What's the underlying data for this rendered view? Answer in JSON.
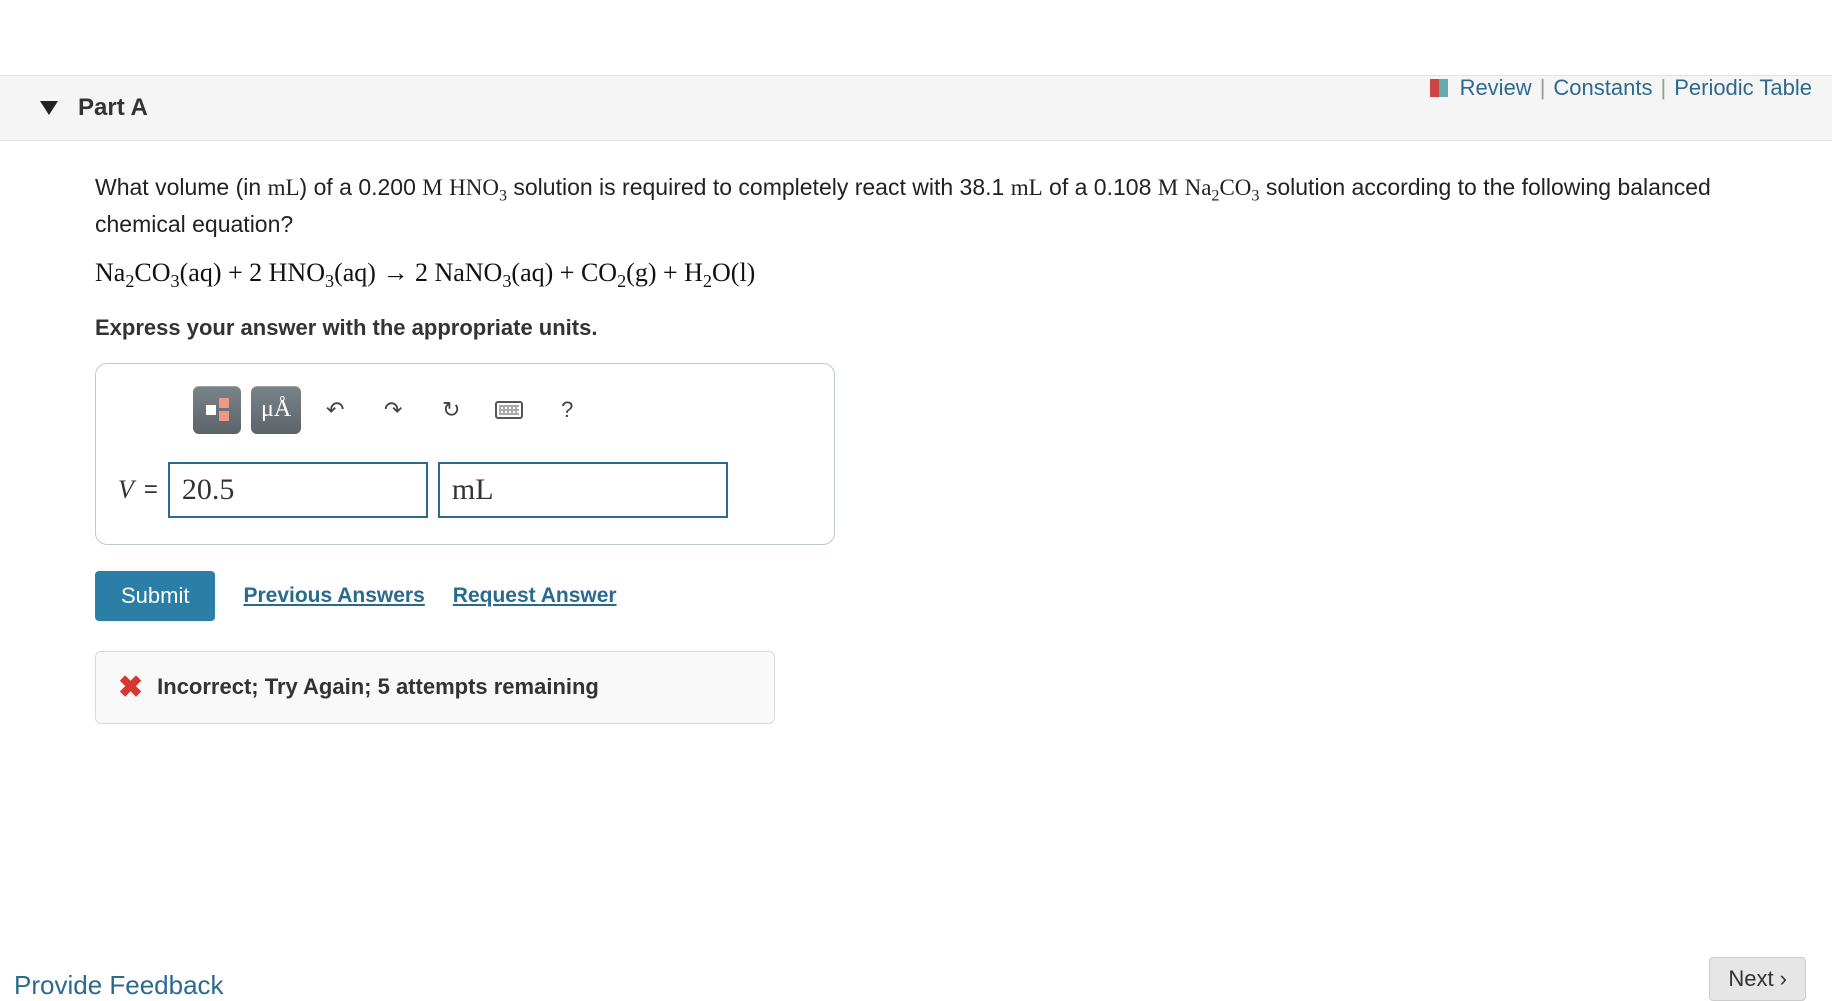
{
  "topLinks": {
    "review": "Review",
    "constants": "Constants",
    "periodic": "Periodic Table"
  },
  "part": {
    "label": "Part A"
  },
  "question": {
    "pre": "What volume (in ",
    "unit_mL": "mL",
    "seg1": ") of a 0.200 ",
    "M": "M",
    "sp": " ",
    "hno3_a": "HNO",
    "hno3_b": "3",
    "seg2": " solution is required to completely react with 38.1 ",
    "seg3": " of a 0.108 ",
    "na2co3_a": "Na",
    "na2co3_b": "2",
    "na2co3_c": "CO",
    "na2co3_d": "3",
    "seg4": " solution according to the following balanced chemical equation?"
  },
  "equation": {
    "t1": "Na",
    "s1": "2",
    "t2": "CO",
    "s2": "3",
    "t3": "(aq) + 2 HNO",
    "s3": "3",
    "t4": "(aq) → 2 NaNO",
    "s4": "3",
    "t5": "(aq) + CO",
    "s5": "2",
    "t6": "(g) +  H",
    "s6": "2",
    "t7": "O(l)"
  },
  "instruct": "Express your answer with the appropriate units.",
  "toolbar": {
    "muA": "μÅ",
    "help": "?"
  },
  "answer": {
    "var": "V",
    "eq": "=",
    "value": "20.5",
    "unit": "mL"
  },
  "actions": {
    "submit": "Submit",
    "prev": "Previous Answers",
    "req": "Request Answer"
  },
  "feedback": {
    "msg": "Incorrect; Try Again; 5 attempts remaining"
  },
  "footer": {
    "provide": "Provide Feedback",
    "next": "Next"
  }
}
